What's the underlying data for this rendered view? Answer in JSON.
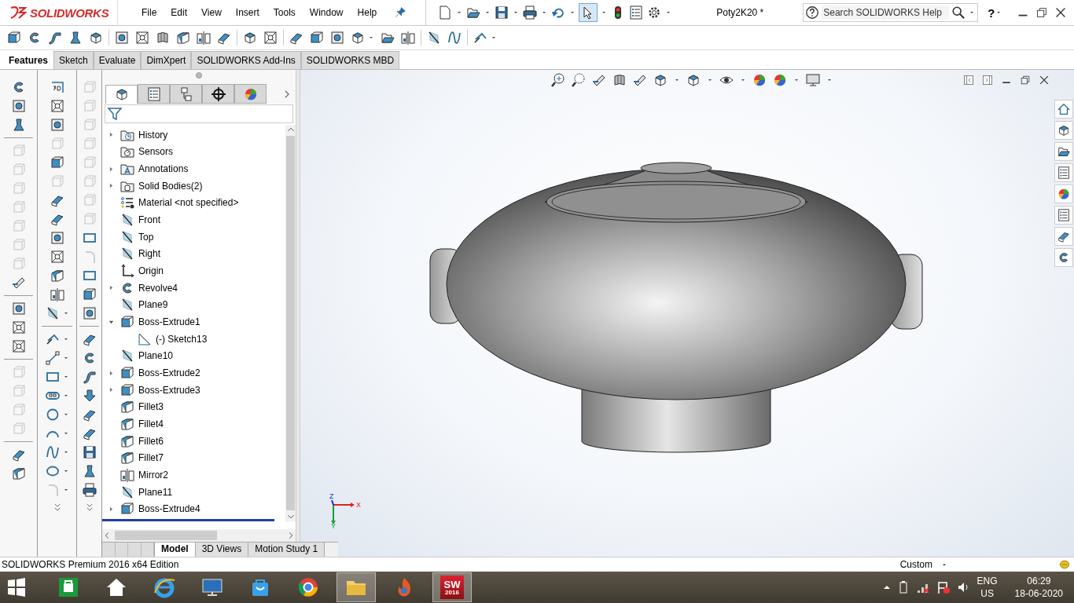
{
  "app": {
    "logo": "SOLIDWORKS"
  },
  "menu": [
    "File",
    "Edit",
    "View",
    "Insert",
    "Tools",
    "Window",
    "Help"
  ],
  "document_title": "Poty2K20 *",
  "help_search": {
    "placeholder": "Search SOLIDWORKS Help"
  },
  "help_button": "?",
  "command_tabs": [
    {
      "label": "Features",
      "selected": true
    },
    {
      "label": "Sketch",
      "selected": false
    },
    {
      "label": "Evaluate",
      "selected": false
    },
    {
      "label": "DimXpert",
      "selected": false
    },
    {
      "label": "SOLIDWORKS Add-Ins",
      "selected": false
    },
    {
      "label": "SOLIDWORKS MBD",
      "selected": false
    }
  ],
  "panel_tabs": [
    {
      "kind": "feature",
      "selected": true
    },
    {
      "kind": "property",
      "selected": false
    },
    {
      "kind": "configuration",
      "selected": false
    },
    {
      "kind": "target",
      "selected": false
    },
    {
      "kind": "appearance",
      "selected": false
    }
  ],
  "feature_tree": [
    {
      "label": "History",
      "kind": "history",
      "expanded": false
    },
    {
      "label": "Sensors",
      "kind": "sensor"
    },
    {
      "label": "Annotations",
      "kind": "annotation",
      "expanded": false
    },
    {
      "label": "Solid Bodies(2)",
      "kind": "bodies",
      "expanded": false
    },
    {
      "label": "Material <not specified>",
      "kind": "material"
    },
    {
      "label": "Front",
      "kind": "plane"
    },
    {
      "label": "Top",
      "kind": "plane"
    },
    {
      "label": "Right",
      "kind": "plane"
    },
    {
      "label": "Origin",
      "kind": "origin"
    },
    {
      "label": "Revolve4",
      "kind": "revolve",
      "expanded": false
    },
    {
      "label": "Plane9",
      "kind": "plane"
    },
    {
      "label": "Boss-Extrude1",
      "kind": "extrude",
      "expanded": true,
      "children": [
        {
          "label": "(-) Sketch13",
          "kind": "sketch"
        }
      ]
    },
    {
      "label": "Plane10",
      "kind": "plane"
    },
    {
      "label": "Boss-Extrude2",
      "kind": "extrude",
      "expanded": false
    },
    {
      "label": "Boss-Extrude3",
      "kind": "extrude",
      "expanded": false
    },
    {
      "label": "Fillet3",
      "kind": "fillet"
    },
    {
      "label": "Fillet4",
      "kind": "fillet"
    },
    {
      "label": "Fillet6",
      "kind": "fillet"
    },
    {
      "label": "Fillet7",
      "kind": "fillet"
    },
    {
      "label": "Mirror2",
      "kind": "mirror"
    },
    {
      "label": "Plane11",
      "kind": "plane"
    },
    {
      "label": "Boss-Extrude4",
      "kind": "extrude",
      "expanded": false
    }
  ],
  "view_tabs": [
    {
      "label": "Model",
      "selected": true
    },
    {
      "label": "3D Views",
      "selected": false
    },
    {
      "label": "Motion Study 1",
      "selected": false
    }
  ],
  "triad": {
    "x": "X",
    "y": "Y",
    "z": "Z"
  },
  "status_bar": {
    "text": "SOLIDWORKS Premium 2016 x64 Edition",
    "units": "Custom"
  },
  "taskbar": {
    "apps": [
      {
        "kind": "store",
        "active": false
      },
      {
        "kind": "home",
        "active": false
      },
      {
        "kind": "ie",
        "active": false
      },
      {
        "kind": "monitor",
        "active": false
      },
      {
        "kind": "bag",
        "active": false
      },
      {
        "kind": "chrome",
        "active": false
      },
      {
        "kind": "explorer",
        "active": true
      },
      {
        "kind": "flame",
        "active": false
      },
      {
        "kind": "solidworks",
        "active": true,
        "letters": "SW",
        "badge": "2016"
      }
    ],
    "language": "ENG",
    "region": "US",
    "time": "06:29",
    "date": "18-06-2020"
  }
}
